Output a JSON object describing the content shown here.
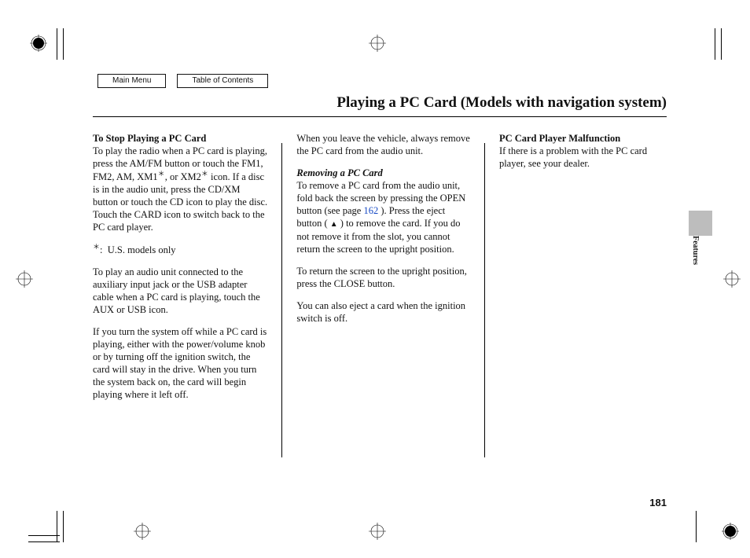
{
  "nav": {
    "main_menu": "Main Menu",
    "toc": "Table of Contents"
  },
  "page_title": "Playing a PC Card (Models with navigation system)",
  "side_tab": "Features",
  "page_number": "181",
  "page_link": "162",
  "asterisk": "＊",
  "eject_glyph": "▲",
  "col1": {
    "h1": "To Stop Playing a PC Card",
    "p1a": "To play the radio when a PC card is playing, press the AM/FM button or touch the FM1, FM2, AM, XM1",
    "p1b": ", or XM2",
    "p1c": " icon. If a disc is in the audio unit, press the CD/XM button or touch the CD icon to play the disc. Touch the CARD icon to switch back to the PC card player.",
    "note": "U.S. models only",
    "note_prefix": ":",
    "p2": "To play an audio unit connected to the auxiliary input jack or the USB adapter cable when a PC card is playing, touch the AUX or USB icon.",
    "p3": "If you turn the system off while a PC card is playing, either with the power/volume knob or by turning off the ignition switch, the card will stay in the drive. When you turn the system back on, the card will begin playing where it left off."
  },
  "col2": {
    "p1": "When you leave the vehicle, always remove the PC card from the audio unit.",
    "h2": "Removing a PC Card",
    "p2a": "To remove a PC card from the audio unit, fold back the screen by pressing the OPEN button (see page ",
    "p2b": " ). Press the eject button (  ",
    "p2c": "  ) to remove the card. If you do not remove it from the slot, you cannot return the screen to the upright position.",
    "p3": "To return the screen to the upright position, press the CLOSE button.",
    "p4": "You can also eject a card when the ignition switch is off."
  },
  "col3": {
    "h3": "PC Card Player Malfunction",
    "p1": "If there is a problem with the PC card player, see your dealer."
  }
}
